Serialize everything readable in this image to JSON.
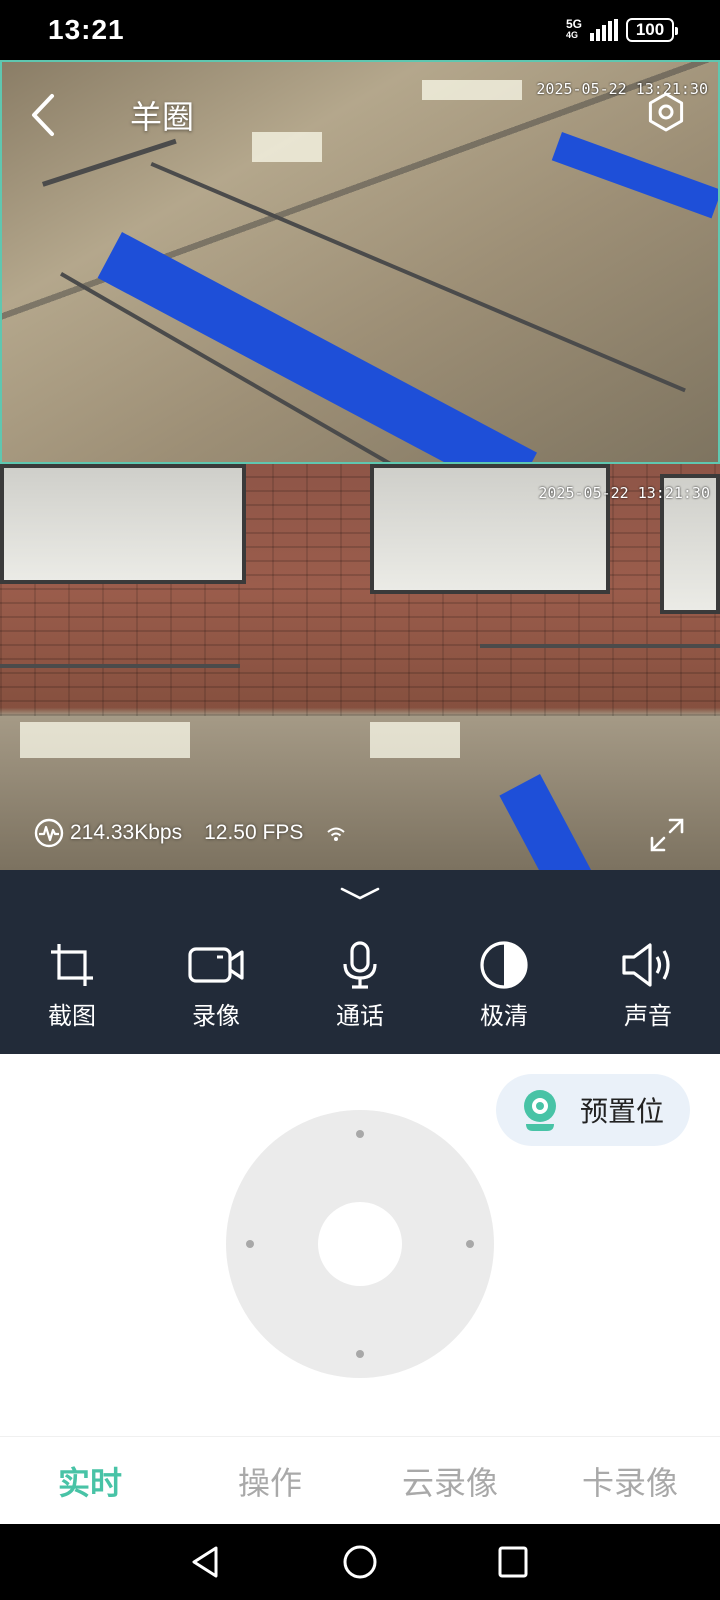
{
  "status_bar": {
    "time": "13:21",
    "network_top": "5G",
    "network_bottom": "4G",
    "battery": "100"
  },
  "header": {
    "title": "羊圈"
  },
  "feeds": [
    {
      "timestamp": "2025-05-22 13:21:30"
    },
    {
      "timestamp": "2025-05-22 13:21:30"
    }
  ],
  "stats": {
    "bitrate": "214.33Kbps",
    "fps": "12.50 FPS"
  },
  "controls": [
    {
      "label": "截图",
      "icon": "crop-icon"
    },
    {
      "label": "录像",
      "icon": "video-camera-icon"
    },
    {
      "label": "通话",
      "icon": "microphone-icon"
    },
    {
      "label": "极清",
      "icon": "contrast-icon"
    },
    {
      "label": "声音",
      "icon": "speaker-icon"
    }
  ],
  "preset": {
    "label": "预置位",
    "icon": "webcam-icon",
    "color": "#48c3a6"
  },
  "tabs": [
    {
      "label": "实时",
      "active": true
    },
    {
      "label": "操作",
      "active": false
    },
    {
      "label": "云录像",
      "active": false
    },
    {
      "label": "卡录像",
      "active": false
    }
  ],
  "colors": {
    "accent": "#48c3a6",
    "control_bar": "#222b39"
  }
}
